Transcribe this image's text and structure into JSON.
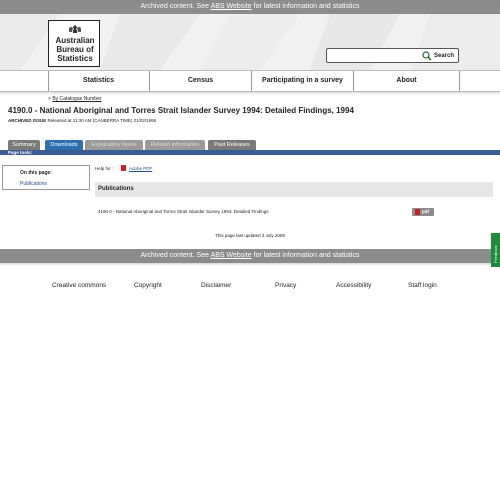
{
  "archive_banner": {
    "prefix": "Archived content. See ",
    "link": "ABS Website",
    "suffix": " for latest information and statistics"
  },
  "logo": {
    "lines": [
      "Australian",
      "Bureau of",
      "Statistics"
    ]
  },
  "search": {
    "placeholder": "",
    "button_label": "Search"
  },
  "nav": {
    "items": [
      "Statistics",
      "Census",
      "Participating in a survey",
      "About"
    ]
  },
  "breadcrumb": {
    "marker": "> ",
    "link": "By Catalogue Number"
  },
  "page": {
    "title": "4190.0 - National Aboriginal and Torres Strait Islander Survey 1994: Detailed Findings, 1994",
    "issue_label": "ARCHIVED ISSUE",
    "issue_text": " Released at 11:30 AM (CANBERRA TIME) 21/02/1995"
  },
  "tabs": [
    "Summary",
    "Downloads",
    "Explanatory Notes",
    "Related Information",
    "Past Releases"
  ],
  "page_tools": "Page tools:",
  "on_this_page": {
    "heading": "On this page:",
    "link": "Publications"
  },
  "help": {
    "label": "Help for  :",
    "link": "Adobe PDF"
  },
  "publications": {
    "heading": "Publications",
    "row_title": "4190.0 - National Aboriginal and Torres Strait Islander Survey 1994: Detailed Findings",
    "pdf_label": "pdf"
  },
  "updated": "This page last updated 3 July 2008",
  "feedback": "Feedback",
  "footer_links": [
    "Creative commons",
    "Copyright",
    "Disclaimer",
    "Privacy",
    "Accessibility",
    "Staff login"
  ],
  "colors": {
    "banner": "#8c8c8c",
    "tab_active": "#2c6fb3",
    "tabs_bar": "#3a5c91",
    "feedback": "#1e8a3a",
    "pdf_red": "#cc1f1f"
  }
}
